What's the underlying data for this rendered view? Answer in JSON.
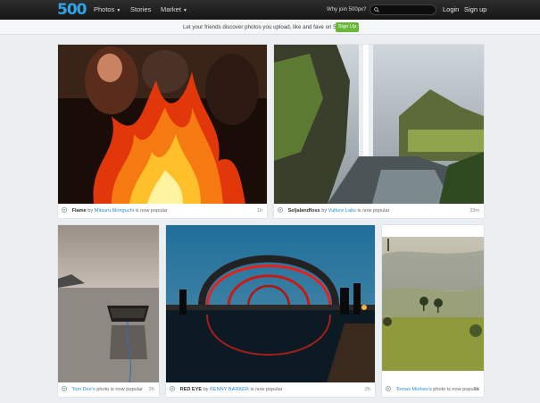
{
  "header": {
    "logo": "500",
    "nav": [
      "Photos",
      "Stories",
      "Market"
    ],
    "why": "Why join 500px?",
    "search_placeholder": "",
    "login": "Login",
    "signup": "Sign up"
  },
  "banner": {
    "text": "Let your friends discover photos you upload, like and fave on 500px",
    "button": "Sign Up"
  },
  "photos": [
    {
      "title": "Flame",
      "by": "by",
      "author": "Mitsuru Moriguchi",
      "status": "is now popular",
      "time": "1h"
    },
    {
      "title": "Seljalandfoss",
      "by": "by",
      "author": "Vulture Labs",
      "status": "is now popular",
      "time": "33m"
    },
    {
      "title": "",
      "by": "",
      "author": "Tom Dee's",
      "status": "photo is now popular",
      "time": "2h"
    },
    {
      "title": "RED EYE",
      "by": "by",
      "author": "KENNY BARKER",
      "status": "is now popular",
      "time": "2h"
    },
    {
      "title": "",
      "by": "",
      "author": "Tomas Morkes's",
      "status": "photo is now popular",
      "time": "2h"
    }
  ]
}
